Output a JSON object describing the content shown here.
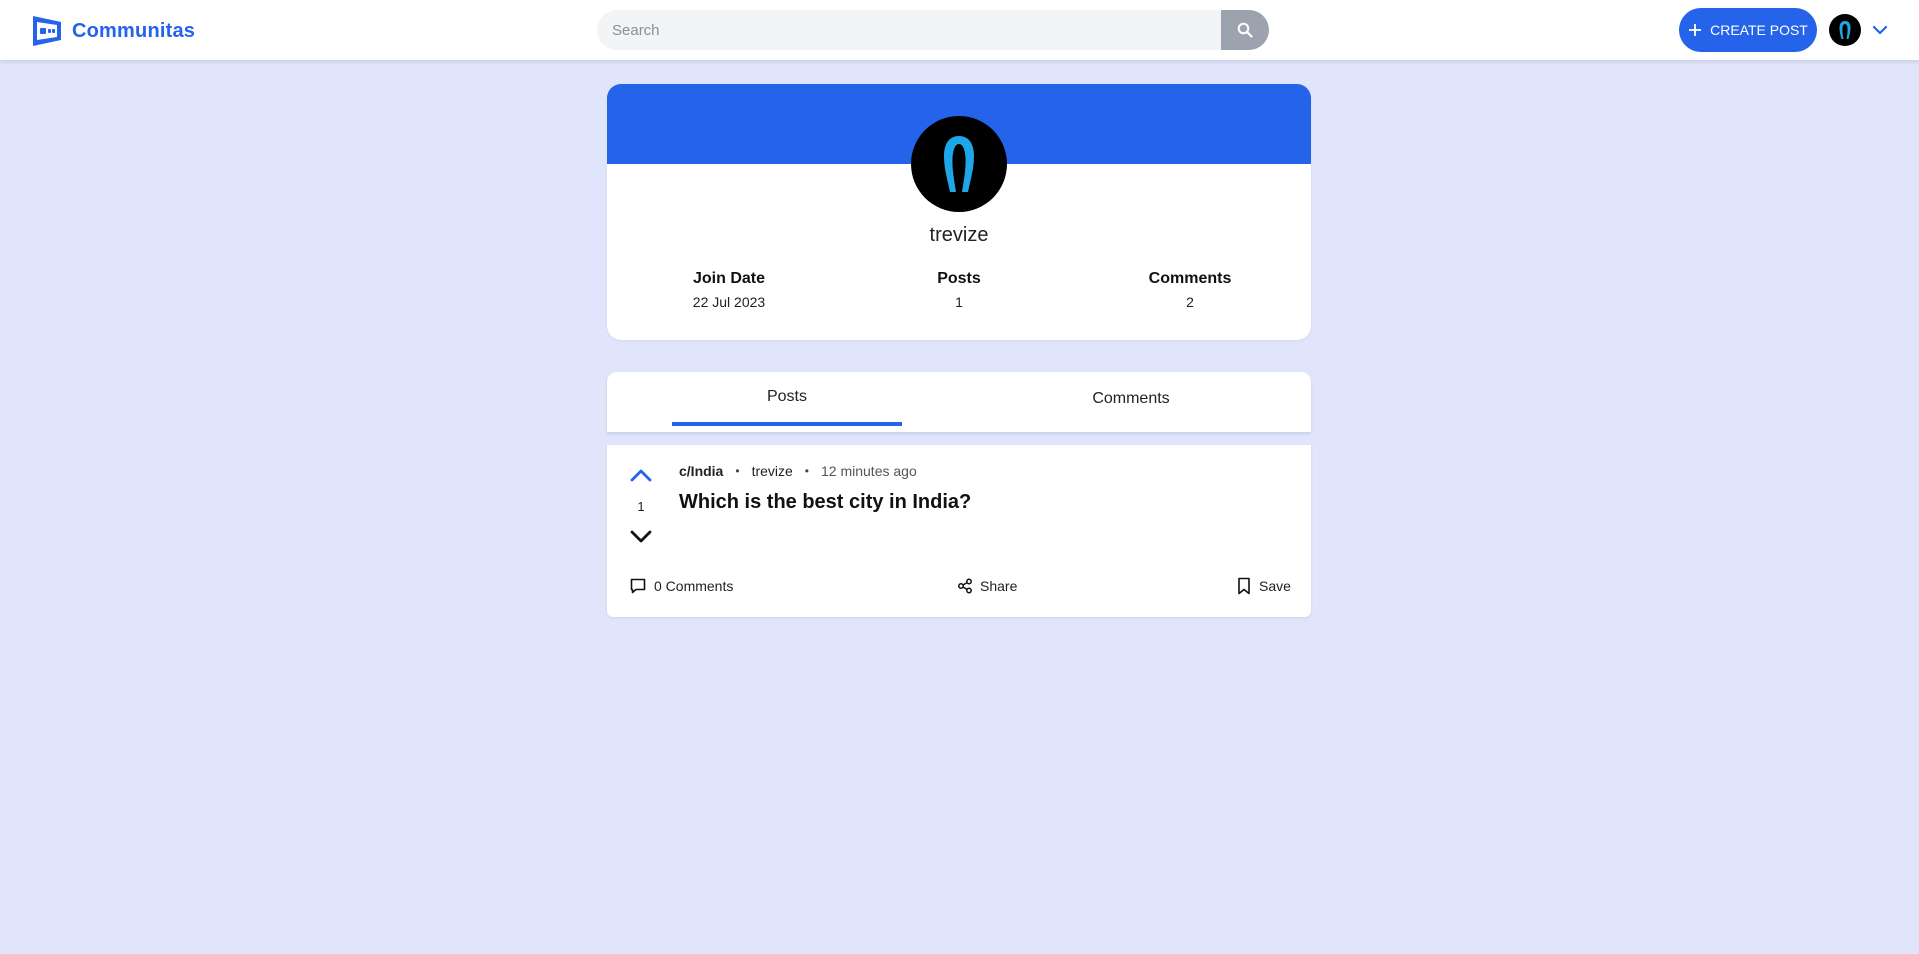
{
  "app": {
    "name": "Communitas",
    "accent": "#2563eb",
    "background": "#e0e5fc"
  },
  "header": {
    "search": {
      "placeholder": "Search",
      "value": ""
    },
    "create_post_label": "CREATE POST",
    "icons": [
      "communitas-logo-icon",
      "search-icon",
      "plus-icon",
      "user-avatar",
      "chevron-down-icon"
    ]
  },
  "profile": {
    "username": "trevize",
    "stats": [
      {
        "label": "Join Date",
        "value": "22 Jul 2023"
      },
      {
        "label": "Posts",
        "value": "1"
      },
      {
        "label": "Comments",
        "value": "2"
      }
    ]
  },
  "tabs": [
    {
      "label": "Posts",
      "active": true
    },
    {
      "label": "Comments",
      "active": false
    }
  ],
  "posts": [
    {
      "community": "c/India",
      "author": "trevize",
      "time": "12 minutes ago",
      "title": "Which is the best city in India?",
      "votes": "1",
      "actions": {
        "comments": "0 Comments",
        "share": "Share",
        "save": "Save"
      }
    }
  ]
}
